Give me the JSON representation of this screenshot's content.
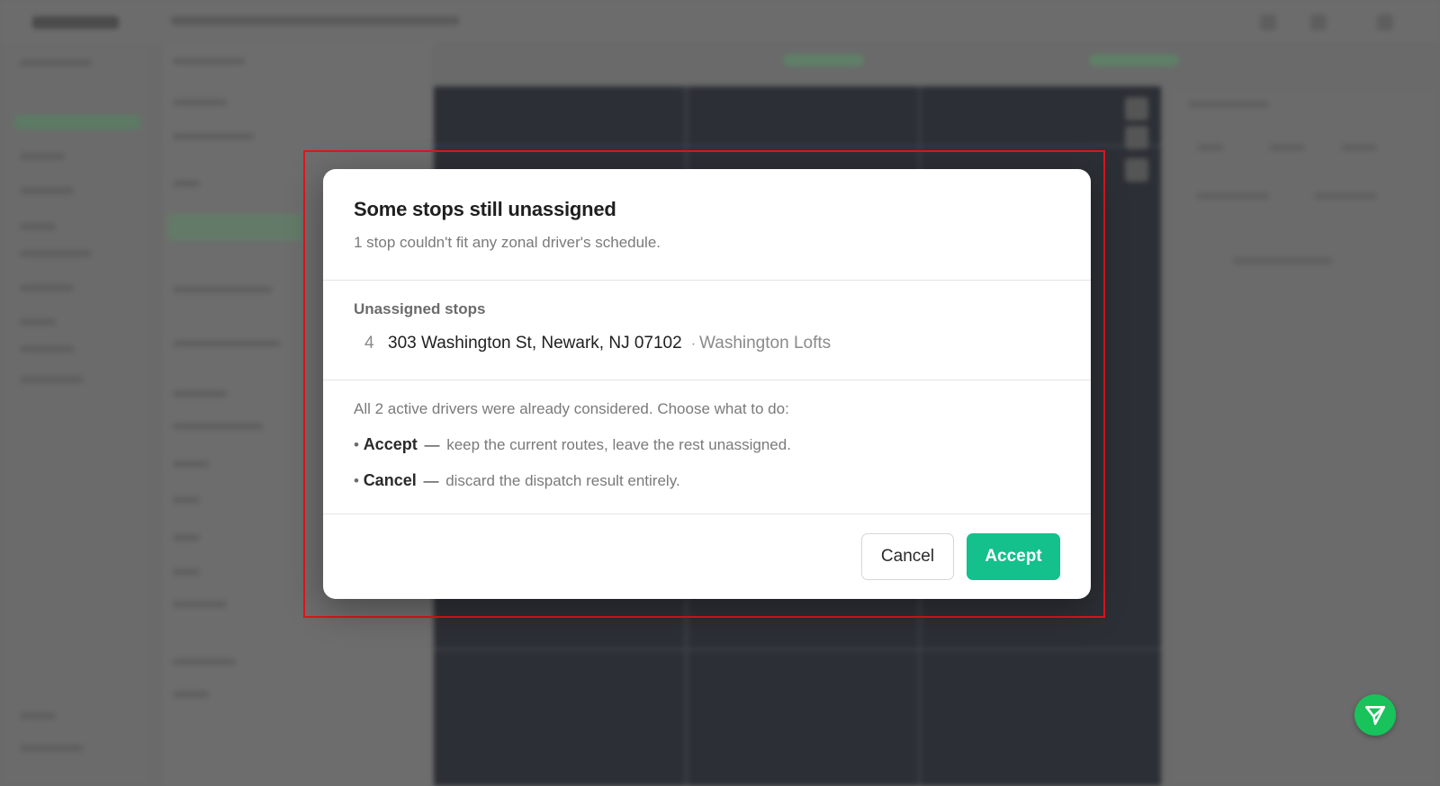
{
  "dialog": {
    "title": "Some stops still unassigned",
    "subtitle": "1 stop couldn't fit any zonal driver's schedule.",
    "unassigned_heading": "Unassigned stops",
    "stops": [
      {
        "number": "4",
        "address": "303 Washington St, Newark, NJ 07102",
        "separator": "·",
        "name": "Washington Lofts"
      }
    ],
    "explanation": "All 2 active drivers were already considered. Choose what to do:",
    "options": [
      {
        "bullet": "•",
        "key": "Accept",
        "dash": "—",
        "desc": "keep the current routes, leave the rest unassigned."
      },
      {
        "bullet": "•",
        "key": "Cancel",
        "dash": "—",
        "desc": "discard the dispatch result entirely."
      }
    ],
    "cancel_label": "Cancel",
    "accept_label": "Accept"
  },
  "colors": {
    "accent": "#14c08b",
    "highlight_border": "#e0141e",
    "fab": "#17c35a"
  },
  "icons": {
    "fab": "send-icon"
  }
}
